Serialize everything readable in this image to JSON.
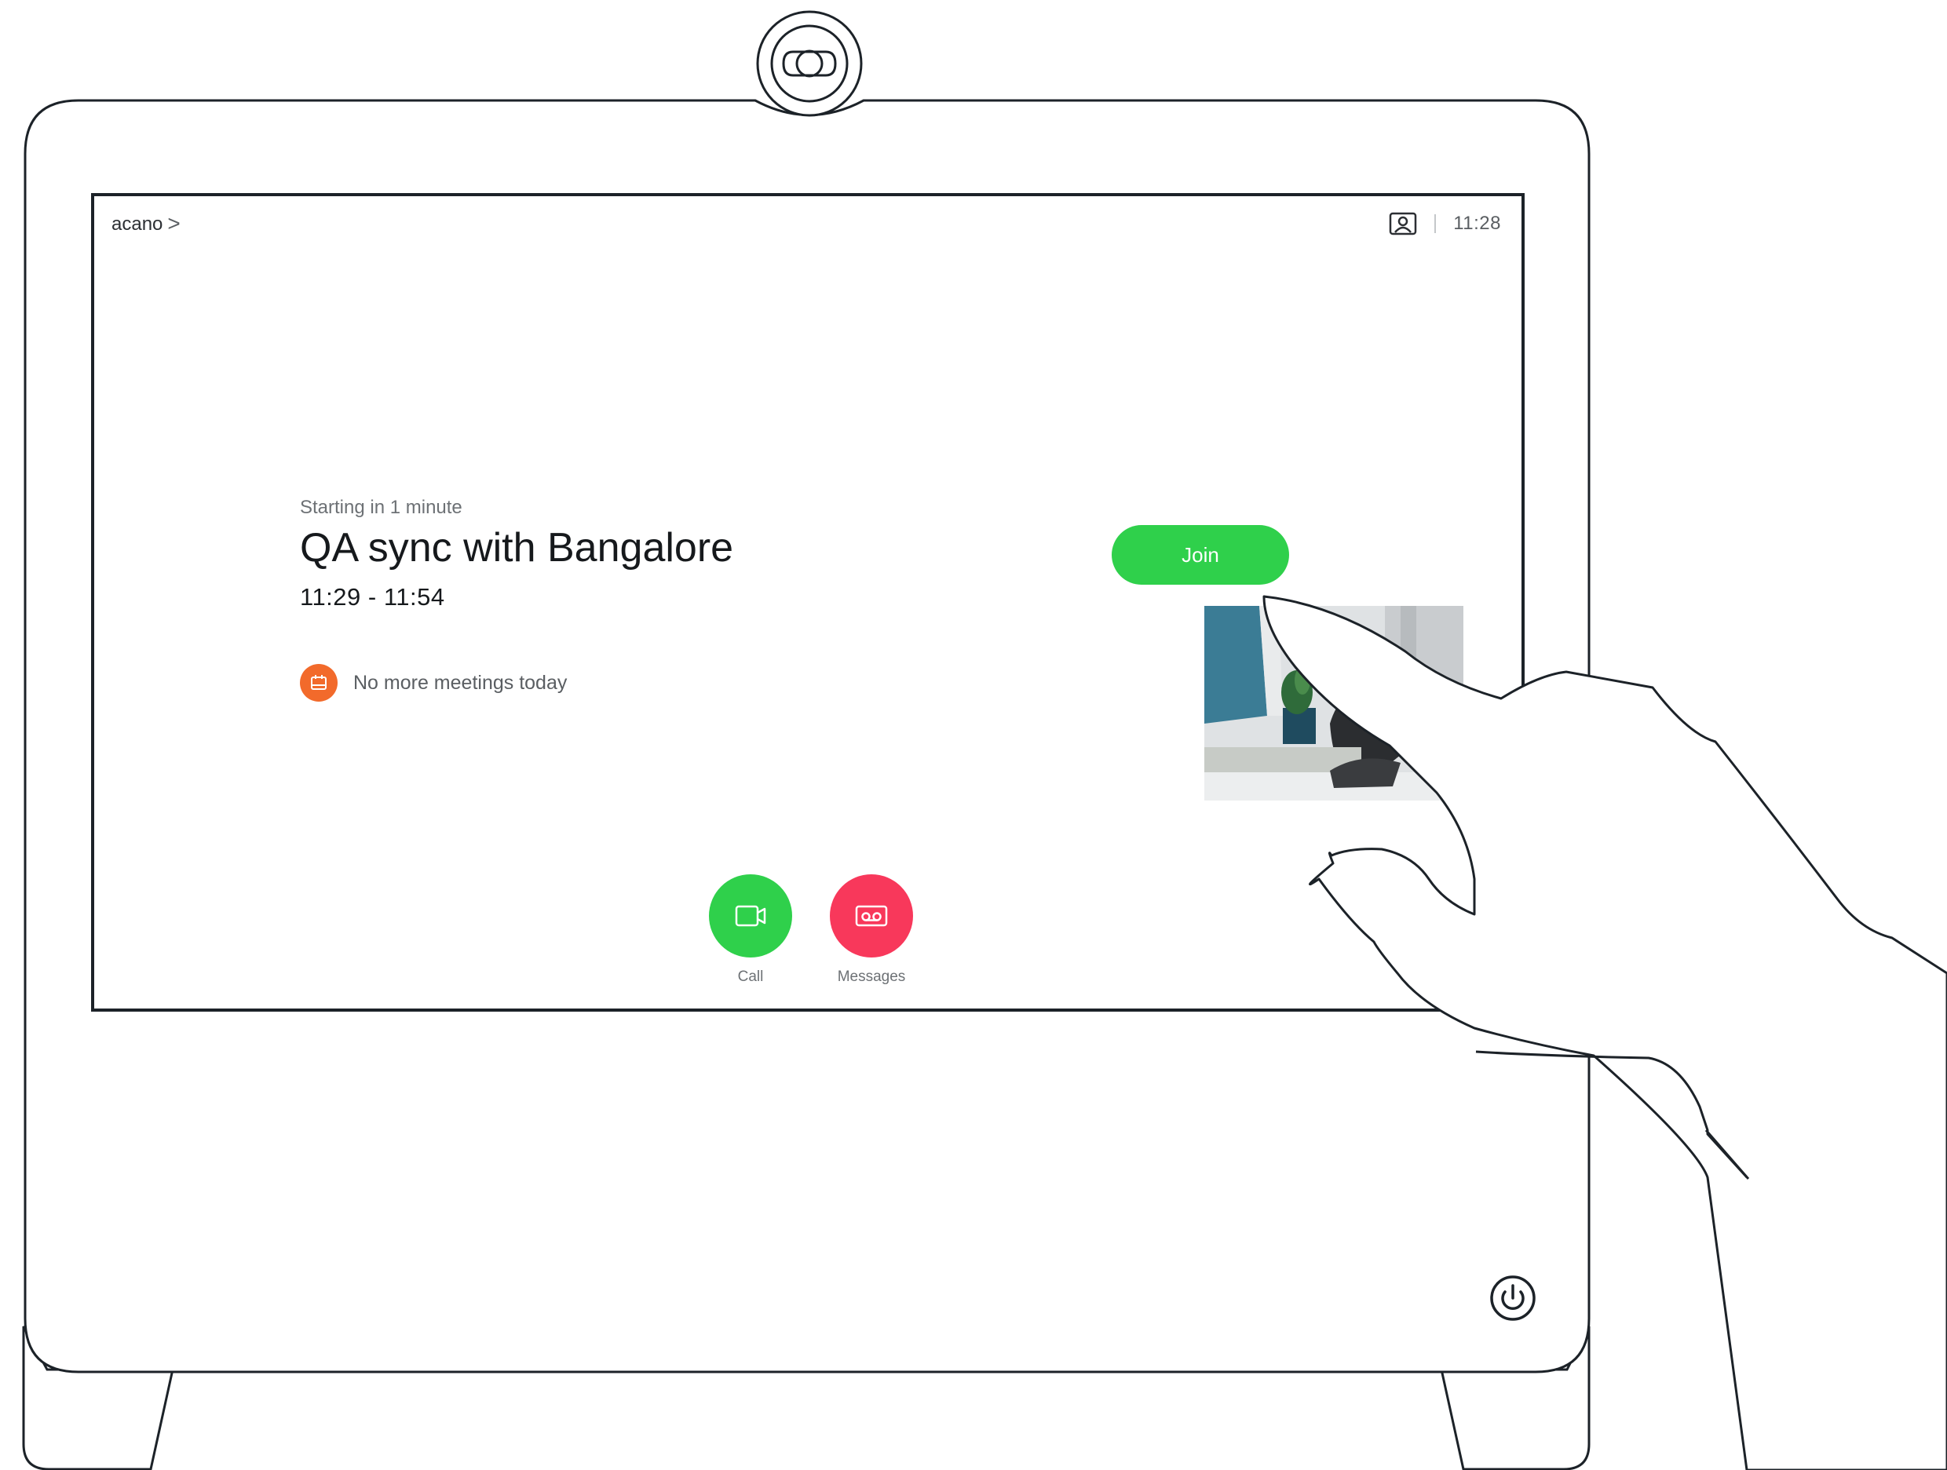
{
  "header": {
    "site_name": "acano",
    "chevron": ">",
    "self_view_icon": "self-view-icon",
    "time": "11:28"
  },
  "meeting": {
    "status": "Starting in 1 minute",
    "title": "QA sync with Bangalore",
    "time_range": "11:29 - 11:54",
    "join_label": "Join"
  },
  "calendar": {
    "icon": "calendar-icon",
    "message": "No more meetings today"
  },
  "actions": [
    {
      "label": "Call",
      "icon": "video-camera-icon",
      "color": "#2fd04b"
    },
    {
      "label": "Messages",
      "icon": "voicemail-icon",
      "color": "#f8385b"
    }
  ],
  "colors": {
    "join": "#2fd04b",
    "calendar_badge": "#f26a2b",
    "messages": "#f8385b",
    "screen_border": "#1c2228"
  },
  "device": {
    "power_icon": "power-icon",
    "camera_icon": "camera-icon"
  }
}
